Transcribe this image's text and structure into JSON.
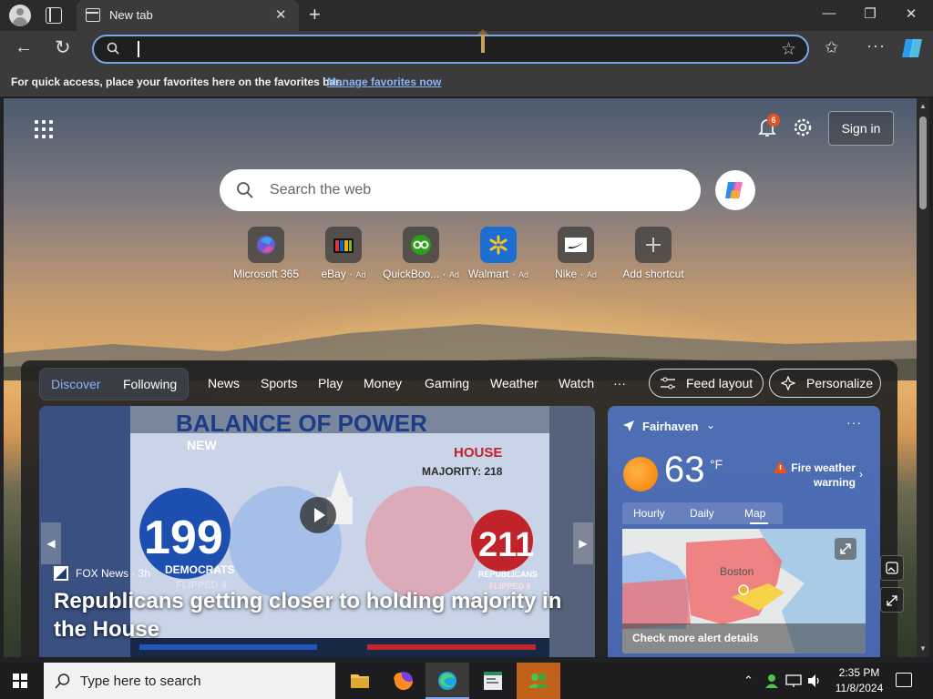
{
  "browser": {
    "tab_title": "New tab",
    "tab_close": "✕",
    "new_tab": "+",
    "window_controls": {
      "minimize": "—",
      "maximize": "❐",
      "close": "✕"
    },
    "address_value": "",
    "favorites_notice": "For quick access, place your favorites here on the favorites bar.",
    "favorites_link": "Manage favorites now",
    "nav_icons": {
      "back": "←",
      "refresh": "↻",
      "favorite": "☆",
      "favorites": "✩",
      "more": "···"
    }
  },
  "newtab": {
    "notifications_count": "6",
    "sign_in": "Sign in",
    "search_placeholder": "Search the web",
    "shortcuts": [
      {
        "label": "Microsoft 365",
        "ad": "",
        "icon": "microsoft-365-icon"
      },
      {
        "label": "eBay",
        "ad": "Ad",
        "icon": "ebay-icon"
      },
      {
        "label": "QuickBoo...",
        "ad": "Ad",
        "icon": "quickbooks-icon"
      },
      {
        "label": "Walmart",
        "ad": "Ad",
        "icon": "walmart-icon"
      },
      {
        "label": "Nike",
        "ad": "Ad",
        "icon": "nike-icon"
      },
      {
        "label": "Add shortcut",
        "ad": "",
        "icon": "plus-icon"
      }
    ],
    "feed": {
      "discover": "Discover",
      "following": "Following",
      "nav": [
        "News",
        "Sports",
        "Play",
        "Money",
        "Gaming",
        "Weather",
        "Watch",
        "···"
      ],
      "feed_layout": "Feed layout",
      "personalize": "Personalize",
      "hero": {
        "source": "FOX News · 3h",
        "headline": "Republicans getting closer to holding majority in the House",
        "graphic": {
          "banner": "BALANCE OF POWER",
          "sub_new": "NEW",
          "house": "HOUSE",
          "majority": "MAJORITY: 218",
          "dem_count": "199",
          "dem_label": "DEMOCRATS",
          "dem_flipped": "FLIPPED 4",
          "rep_count": "211",
          "rep_label": "REPUBLICANS",
          "rep_flipped": "FLIPPED 6"
        }
      },
      "weather": {
        "location": "Fairhaven",
        "temperature": "63",
        "unit": "°F",
        "alert": "Fire weather warning",
        "tabs": [
          "Hourly",
          "Daily",
          "Map"
        ],
        "active_tab": "Map",
        "map_city": "Boston",
        "map_cta": "Check more alert details"
      }
    }
  },
  "taskbar": {
    "search_placeholder": "Type here to search",
    "time": "2:35 PM",
    "date": "11/8/2024",
    "colors": {
      "accent": "#7aa7ea",
      "highlight": "#c0621a"
    }
  }
}
